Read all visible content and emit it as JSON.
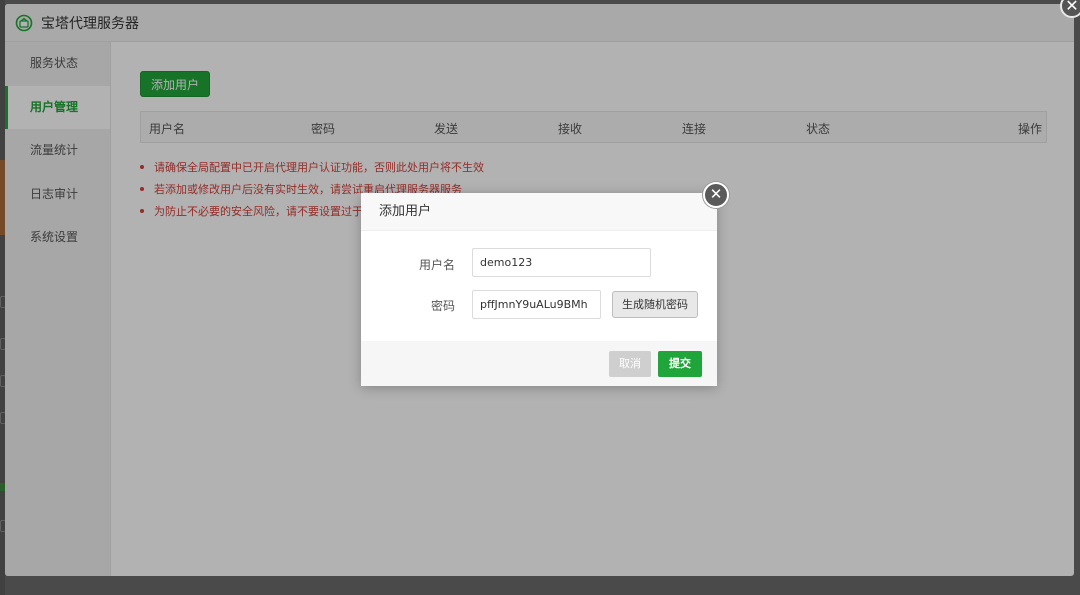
{
  "window": {
    "title": "宝塔代理服务器"
  },
  "sidebar": {
    "items": [
      {
        "label": "服务状态"
      },
      {
        "label": "用户管理"
      },
      {
        "label": "流量统计"
      },
      {
        "label": "日志审计"
      },
      {
        "label": "系统设置"
      }
    ],
    "active_index": 1
  },
  "main": {
    "add_user_button": "添加用户",
    "table": {
      "columns": [
        "用户名",
        "密码",
        "发送",
        "接收",
        "连接",
        "状态",
        "操作"
      ],
      "rows": []
    },
    "tips": [
      "请确保全局配置中已开启代理用户认证功能，否则此处用户将不生效",
      "若添加或修改用户后没有实时生效，请尝试重启代理服务器服务",
      "为防止不必要的安全风险，请不要设置过于简"
    ]
  },
  "dialog": {
    "title": "添加用户",
    "close_symbol": "✕",
    "username_label": "用户名",
    "username_value": "demo123",
    "password_label": "密码",
    "password_value": "pffJmnY9uALu9BMh",
    "generate_button": "生成随机密码",
    "cancel_button": "取消",
    "submit_button": "提交"
  },
  "outer_close_symbol": "✕",
  "colors": {
    "accent": "#20a53a",
    "warning_text": "#d43f3a",
    "overlay": "rgba(0,0,0,0.30)"
  }
}
